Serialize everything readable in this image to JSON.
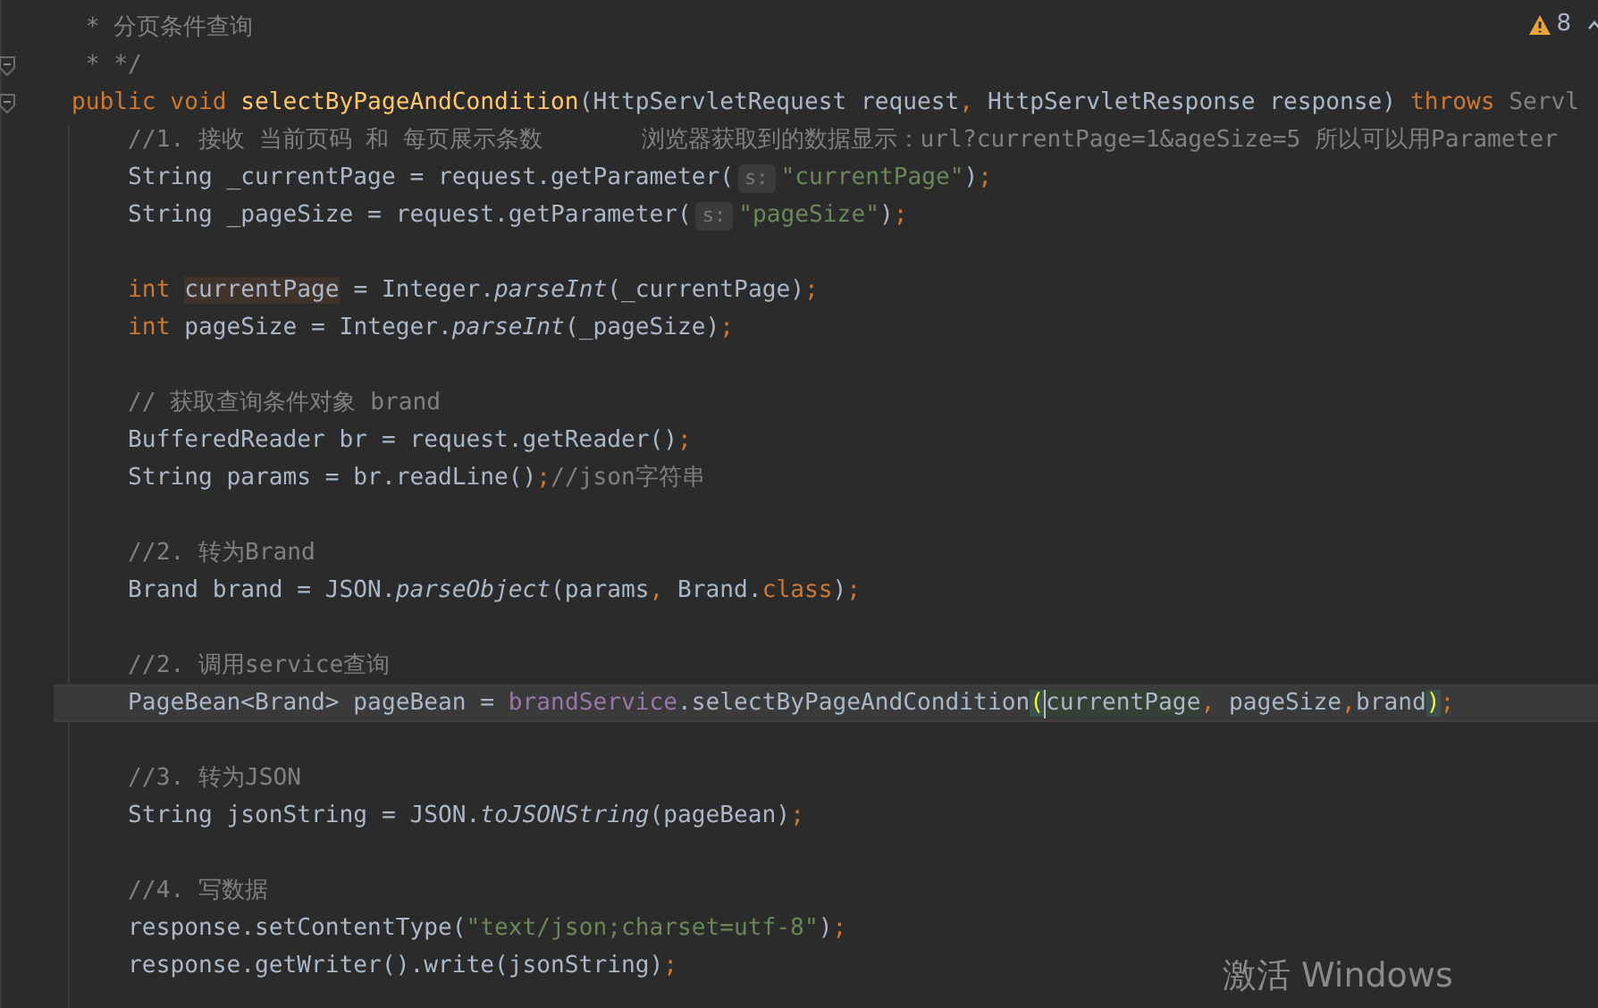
{
  "inspection": {
    "warning_count": "8"
  },
  "lines": [
    {
      "kind": "code",
      "current": false,
      "tokens": [
        {
          "kind": "comment",
          "text": " * 分页条件查询"
        }
      ]
    },
    {
      "kind": "code",
      "current": false,
      "fold": true,
      "tokens": [
        {
          "kind": "comment",
          "text": " * */"
        }
      ]
    },
    {
      "kind": "code",
      "current": false,
      "fold": true,
      "tokens": [
        {
          "kind": "keyword",
          "text": "public void "
        },
        {
          "kind": "decl",
          "text": "selectByPageAndCondition"
        },
        {
          "kind": "plain",
          "text": "(HttpServletRequest request"
        },
        {
          "kind": "keyword",
          "text": ","
        },
        {
          "kind": "plain",
          "text": " HttpServletResponse response) "
        },
        {
          "kind": "keyword",
          "text": "throws "
        },
        {
          "kind": "dim",
          "text": "Servl"
        }
      ]
    },
    {
      "kind": "code",
      "current": false,
      "tokens": [
        {
          "kind": "comment",
          "text": "    //1. 接收 当前页码 和 每页展示条数       浏览器获取到的数据显示：url?currentPage=1&ageSize=5 所以可以用Parameter"
        }
      ]
    },
    {
      "kind": "code",
      "current": false,
      "tokens": [
        {
          "kind": "plain",
          "text": "    String _currentPage = request.getParameter("
        },
        {
          "kind": "hint",
          "text": "s:"
        },
        {
          "kind": "string",
          "text": "\"currentPage\""
        },
        {
          "kind": "plain",
          "text": ")"
        },
        {
          "kind": "keyword",
          "text": ";"
        }
      ]
    },
    {
      "kind": "code",
      "current": false,
      "tokens": [
        {
          "kind": "plain",
          "text": "    String _pageSize = request.getParameter("
        },
        {
          "kind": "hint",
          "text": "s:"
        },
        {
          "kind": "string",
          "text": "\"pageSize\""
        },
        {
          "kind": "plain",
          "text": ")"
        },
        {
          "kind": "keyword",
          "text": ";"
        }
      ]
    },
    {
      "kind": "blank",
      "current": false
    },
    {
      "kind": "code",
      "current": false,
      "tokens": [
        {
          "kind": "keyword",
          "text": "    int "
        },
        {
          "kind": "usage",
          "text": "currentPage"
        },
        {
          "kind": "plain",
          "text": " = Integer."
        },
        {
          "kind": "static",
          "text": "parseInt"
        },
        {
          "kind": "plain",
          "text": "(_currentPage)"
        },
        {
          "kind": "keyword",
          "text": ";"
        }
      ]
    },
    {
      "kind": "code",
      "current": false,
      "tokens": [
        {
          "kind": "keyword",
          "text": "    int "
        },
        {
          "kind": "plain",
          "text": "pageSize = Integer."
        },
        {
          "kind": "static",
          "text": "parseInt"
        },
        {
          "kind": "plain",
          "text": "(_pageSize)"
        },
        {
          "kind": "keyword",
          "text": ";"
        }
      ]
    },
    {
      "kind": "blank",
      "current": false
    },
    {
      "kind": "code",
      "current": false,
      "tokens": [
        {
          "kind": "comment",
          "text": "    // 获取查询条件对象 brand"
        }
      ]
    },
    {
      "kind": "code",
      "current": false,
      "tokens": [
        {
          "kind": "plain",
          "text": "    BufferedReader br = request.getReader()"
        },
        {
          "kind": "keyword",
          "text": ";"
        }
      ]
    },
    {
      "kind": "code",
      "current": false,
      "tokens": [
        {
          "kind": "plain",
          "text": "    String params = br.readLine()"
        },
        {
          "kind": "keyword",
          "text": ";"
        },
        {
          "kind": "comment",
          "text": "//json字符串"
        }
      ]
    },
    {
      "kind": "blank",
      "current": false
    },
    {
      "kind": "code",
      "current": false,
      "tokens": [
        {
          "kind": "comment",
          "text": "    //2. 转为Brand"
        }
      ]
    },
    {
      "kind": "code",
      "current": false,
      "tokens": [
        {
          "kind": "plain",
          "text": "    Brand brand = JSON."
        },
        {
          "kind": "static",
          "text": "parseObject"
        },
        {
          "kind": "plain",
          "text": "(params"
        },
        {
          "kind": "keyword",
          "text": ","
        },
        {
          "kind": "plain",
          "text": " Brand."
        },
        {
          "kind": "keyword",
          "text": "class"
        },
        {
          "kind": "plain",
          "text": ")"
        },
        {
          "kind": "keyword",
          "text": ";"
        }
      ]
    },
    {
      "kind": "blank",
      "current": false
    },
    {
      "kind": "code",
      "current": false,
      "tokens": [
        {
          "kind": "comment",
          "text": "    //2. 调用service查询"
        }
      ]
    },
    {
      "kind": "code",
      "current": true,
      "tokens": [
        {
          "kind": "plain",
          "text": "    PageBean<Brand> pageBean = "
        },
        {
          "kind": "field",
          "text": "brandService"
        },
        {
          "kind": "plain",
          "text": ".selectByPageAndCondition"
        },
        {
          "kind": "brace",
          "text": "("
        },
        {
          "kind": "caret"
        },
        {
          "kind": "match",
          "text": "currentPage"
        },
        {
          "kind": "keyword",
          "text": ","
        },
        {
          "kind": "plain",
          "text": " pageSize"
        },
        {
          "kind": "keyword",
          "text": ","
        },
        {
          "kind": "plain",
          "text": "brand"
        },
        {
          "kind": "brace",
          "text": ")"
        },
        {
          "kind": "keyword",
          "text": ";"
        }
      ]
    },
    {
      "kind": "blank",
      "current": false
    },
    {
      "kind": "code",
      "current": false,
      "tokens": [
        {
          "kind": "comment",
          "text": "    //3. 转为JSON"
        }
      ]
    },
    {
      "kind": "code",
      "current": false,
      "tokens": [
        {
          "kind": "plain",
          "text": "    String jsonString = JSON."
        },
        {
          "kind": "static",
          "text": "toJSONString"
        },
        {
          "kind": "plain",
          "text": "(pageBean)"
        },
        {
          "kind": "keyword",
          "text": ";"
        }
      ]
    },
    {
      "kind": "blank",
      "current": false
    },
    {
      "kind": "code",
      "current": false,
      "tokens": [
        {
          "kind": "comment",
          "text": "    //4. 写数据"
        }
      ]
    },
    {
      "kind": "code",
      "current": false,
      "tokens": [
        {
          "kind": "plain",
          "text": "    response.setContentType("
        },
        {
          "kind": "string",
          "text": "\"text/json;charset=utf-8\""
        },
        {
          "kind": "plain",
          "text": ")"
        },
        {
          "kind": "keyword",
          "text": ";"
        }
      ]
    },
    {
      "kind": "code",
      "current": false,
      "tokens": [
        {
          "kind": "plain",
          "text": "    response.getWriter().write(jsonString)"
        },
        {
          "kind": "keyword",
          "text": ";"
        }
      ]
    }
  ],
  "os_overlay": {
    "text": "激活 Windows"
  }
}
